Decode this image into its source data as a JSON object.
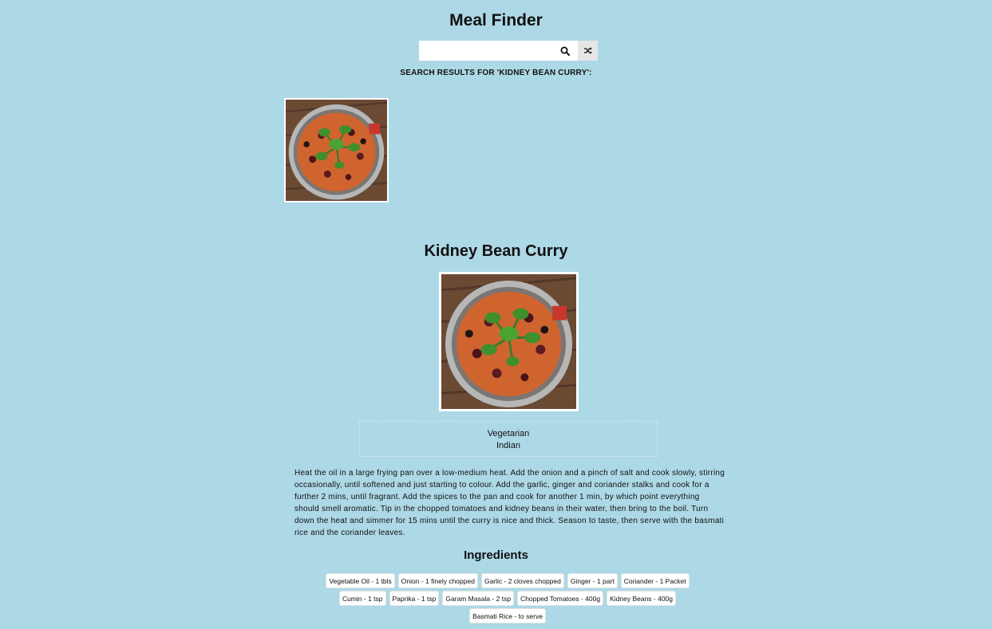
{
  "app": {
    "title": "Meal Finder"
  },
  "search": {
    "value": "",
    "placeholder": ""
  },
  "results": {
    "heading": "SEARCH RESULTS FOR 'KIDNEY BEAN CURRY':",
    "meals": [
      {
        "name": "Kidney Bean Curry"
      }
    ]
  },
  "meal": {
    "title": "Kidney Bean Curry",
    "category": "Vegetarian",
    "area": "Indian",
    "instructions": "Heat the oil in a large frying pan over a low-medium heat. Add the onion and a pinch of salt and cook slowly, stirring occasionally, until softened and just starting to colour. Add the garlic, ginger and coriander stalks and cook for a further 2 mins, until fragrant. Add the spices to the pan and cook for another 1 min, by which point everything should smell aromatic. Tip in the chopped tomatoes and kidney beans in their water, then bring to the boil. Turn down the heat and simmer for 15 mins until the curry is nice and thick. Season to taste, then serve with the basmati rice and the coriander leaves.",
    "ingredients_title": "Ingredients",
    "ingredients": [
      "Vegetable Oil - 1 tbls",
      "Onion - 1 finely chopped",
      "Garlic - 2 cloves chopped",
      "Ginger - 1 part",
      "Coriander - 1 Packet",
      "Cumin - 1 tsp",
      "Paprika - 1 tsp",
      "Garam Masala - 2 tsp",
      "Chopped Tomatoes - 400g",
      "Kidney Beans - 400g",
      "Basmati Rice - to serve"
    ]
  },
  "icons": {
    "search": "search-icon",
    "random": "shuffle-icon"
  },
  "colors": {
    "background": "#add8e6",
    "random_button": "#e6e6e6"
  }
}
